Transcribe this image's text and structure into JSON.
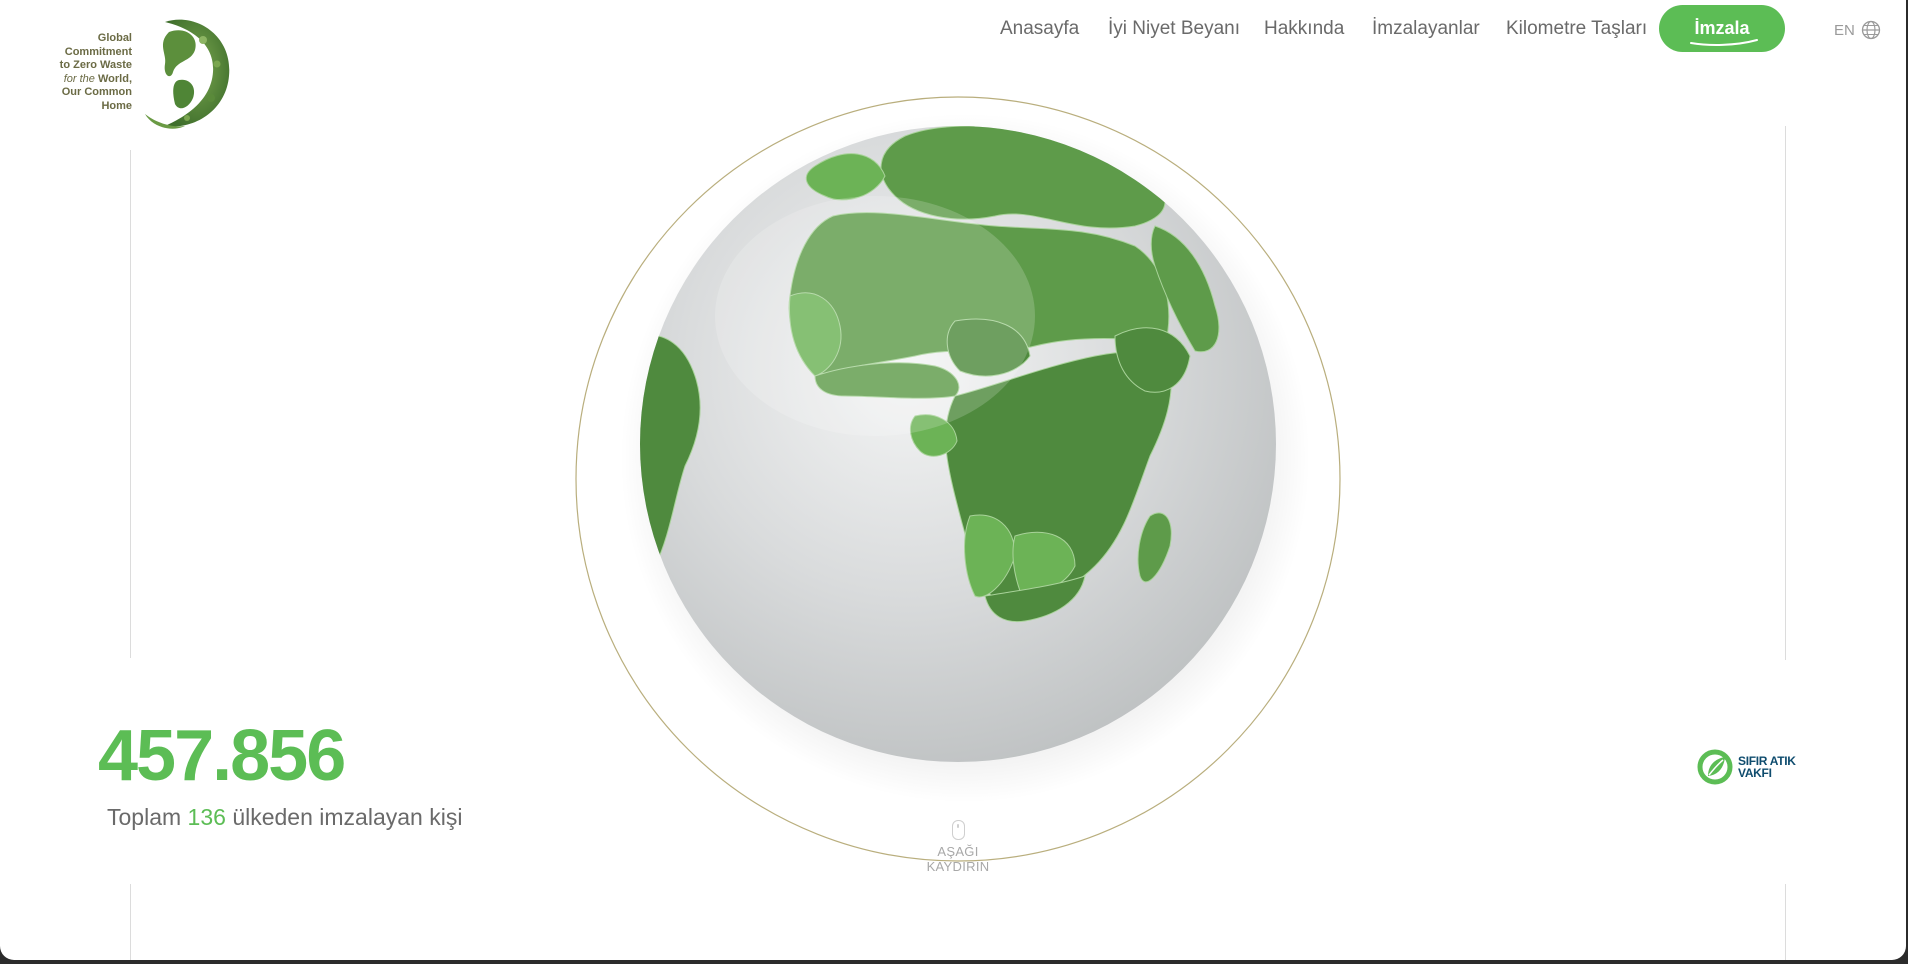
{
  "logo": {
    "lines": [
      "Global",
      "Commitment",
      "to Zero Waste",
      "for the",
      "World,",
      "Our Common",
      "Home"
    ]
  },
  "nav": {
    "items": [
      {
        "label": "Anasayfa"
      },
      {
        "label": "İyi Niyet Beyanı"
      },
      {
        "label": "Hakkında"
      },
      {
        "label": "İmzalayanlar"
      },
      {
        "label": "Kilometre Taşları"
      }
    ],
    "cta_label": "İmzala",
    "lang_label": "EN"
  },
  "stats": {
    "total_signatures": "457.856",
    "sub_prefix": "Toplam",
    "country_count": "136",
    "sub_suffix": "ülkeden imzalayan kişi"
  },
  "scroll_hint": {
    "label": "AŞAĞI KAYDIRIN"
  },
  "foundation": {
    "line1": "SIFIR ATIK",
    "line2": "VAKFI"
  },
  "colors": {
    "accent": "#5cbd55",
    "text": "#6a6a6a",
    "globe_ocean": "#d4d6d7",
    "land_dark": "#4f8a3e",
    "land_mid": "#5e9b4a",
    "land_light": "#6cb356",
    "orbit_ring": "#a89a5c",
    "foundation": "#0f4c6e"
  }
}
